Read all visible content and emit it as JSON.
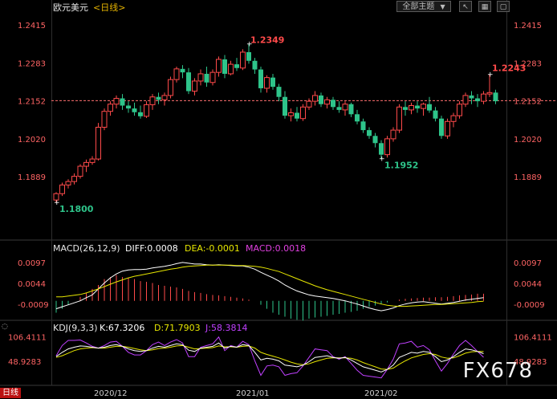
{
  "title": {
    "pair": "欧元美元",
    "period": "<日线>"
  },
  "toolbar": {
    "theme_label": "全部主题",
    "dropdown_icon": "triangle-down-icon",
    "cursor_icon": "cursor-icon",
    "calendar_icon": "calendar-icon",
    "box_icon": "box-icon"
  },
  "colors": {
    "up": "#ff4a4a",
    "down": "#2ec48a",
    "price_axis": "#ff6464",
    "diff": "#ffffff",
    "dea": "#e6e600",
    "macd": "#e040e0",
    "k": "#ffffff",
    "d": "#e6e600",
    "j": "#c040ff",
    "ref_line": "#ff7070"
  },
  "price": {
    "ticks": [
      "1.2415",
      "1.2283",
      "1.2152",
      "1.2020",
      "1.1889"
    ],
    "ref_value": 1.2152,
    "labels": {
      "high": "1.2349",
      "low": "1.1800",
      "recent_high": "1.2243",
      "swing_low": "1.1952"
    }
  },
  "macd": {
    "header": "MACD(26,12,9)",
    "diff_label": "DIFF:0.0008",
    "dea_label": "DEA:-0.0001",
    "macd_label": "MACD:0.0018",
    "ticks": [
      "0.0097",
      "0.0044",
      "-0.0009"
    ]
  },
  "kdj": {
    "header": "KDJ(9,3,3)",
    "k_label": "K:67.3206",
    "d_label": "D:71.7903",
    "j_label": "J:58.3814",
    "ticks": [
      "106.4111",
      "48.9283"
    ]
  },
  "dates": [
    "2020/12",
    "2021/01",
    "2021/02"
  ],
  "period_tag": "日线",
  "watermark": "FX678",
  "chart_data": {
    "type": "candlestick",
    "series_note": "daily OHLC, EUR/USD",
    "ylim": [
      1.175,
      1.2445
    ],
    "candles": [
      [
        1.1808,
        1.1835,
        1.18,
        1.183
      ],
      [
        1.183,
        1.1868,
        1.1822,
        1.186
      ],
      [
        1.186,
        1.188,
        1.1848,
        1.1872
      ],
      [
        1.1872,
        1.19,
        1.1862,
        1.189
      ],
      [
        1.189,
        1.1932,
        1.1882,
        1.1925
      ],
      [
        1.1925,
        1.1948,
        1.1905,
        1.1938
      ],
      [
        1.1938,
        1.196,
        1.193,
        1.195
      ],
      [
        1.195,
        1.2075,
        1.1945,
        1.206
      ],
      [
        1.206,
        1.2125,
        1.205,
        1.2115
      ],
      [
        1.2115,
        1.215,
        1.21,
        1.214
      ],
      [
        1.214,
        1.217,
        1.2125,
        1.216
      ],
      [
        1.216,
        1.2175,
        1.212,
        1.2135
      ],
      [
        1.2135,
        1.215,
        1.211,
        1.2125
      ],
      [
        1.2125,
        1.2145,
        1.21,
        1.2112
      ],
      [
        1.2112,
        1.2135,
        1.209,
        1.2098
      ],
      [
        1.2098,
        1.215,
        1.2092,
        1.2138
      ],
      [
        1.2138,
        1.2175,
        1.212,
        1.2165
      ],
      [
        1.2165,
        1.218,
        1.214,
        1.2155
      ],
      [
        1.2155,
        1.218,
        1.2135,
        1.217
      ],
      [
        1.217,
        1.2235,
        1.216,
        1.2225
      ],
      [
        1.2225,
        1.227,
        1.2215,
        1.2262
      ],
      [
        1.2262,
        1.2275,
        1.223,
        1.225
      ],
      [
        1.225,
        1.2265,
        1.2175,
        1.2185
      ],
      [
        1.2185,
        1.223,
        1.217,
        1.222
      ],
      [
        1.222,
        1.226,
        1.2205,
        1.2245
      ],
      [
        1.2245,
        1.227,
        1.22,
        1.2215
      ],
      [
        1.2215,
        1.226,
        1.2205,
        1.225
      ],
      [
        1.225,
        1.2305,
        1.2235,
        1.2295
      ],
      [
        1.2295,
        1.231,
        1.223,
        1.2245
      ],
      [
        1.2245,
        1.229,
        1.224,
        1.2278
      ],
      [
        1.2278,
        1.23,
        1.2255,
        1.2265
      ],
      [
        1.2265,
        1.233,
        1.2258,
        1.232
      ],
      [
        1.232,
        1.2349,
        1.228,
        1.229
      ],
      [
        1.229,
        1.23,
        1.2245,
        1.226
      ],
      [
        1.226,
        1.227,
        1.218,
        1.2195
      ],
      [
        1.2195,
        1.224,
        1.218,
        1.2232
      ],
      [
        1.2232,
        1.2245,
        1.219,
        1.22
      ],
      [
        1.22,
        1.221,
        1.215,
        1.2165
      ],
      [
        1.2165,
        1.2185,
        1.209,
        1.21
      ],
      [
        1.21,
        1.2125,
        1.208,
        1.211
      ],
      [
        1.211,
        1.213,
        1.208,
        1.209
      ],
      [
        1.209,
        1.214,
        1.2082,
        1.213
      ],
      [
        1.213,
        1.216,
        1.212,
        1.215
      ],
      [
        1.215,
        1.2185,
        1.2135,
        1.217
      ],
      [
        1.217,
        1.218,
        1.213,
        1.214
      ],
      [
        1.214,
        1.2165,
        1.2125,
        1.2155
      ],
      [
        1.2155,
        1.2165,
        1.212,
        1.213
      ],
      [
        1.213,
        1.215,
        1.211,
        1.212
      ],
      [
        1.212,
        1.215,
        1.21,
        1.214
      ],
      [
        1.214,
        1.2145,
        1.2095,
        1.2105
      ],
      [
        1.2105,
        1.212,
        1.207,
        1.208
      ],
      [
        1.208,
        1.209,
        1.204,
        1.205
      ],
      [
        1.205,
        1.206,
        1.202,
        1.203
      ],
      [
        1.203,
        1.204,
        1.199,
        1.2005
      ],
      [
        1.2005,
        1.2015,
        1.1952,
        1.1965
      ],
      [
        1.1965,
        1.203,
        1.1955,
        1.202
      ],
      [
        1.202,
        1.206,
        1.201,
        1.205
      ],
      [
        1.205,
        1.214,
        1.204,
        1.213
      ],
      [
        1.213,
        1.215,
        1.21,
        1.212
      ],
      [
        1.212,
        1.2145,
        1.2105,
        1.2135
      ],
      [
        1.2135,
        1.215,
        1.211,
        1.2125
      ],
      [
        1.2125,
        1.2145,
        1.21,
        1.214
      ],
      [
        1.214,
        1.2165,
        1.211,
        1.2118
      ],
      [
        1.2118,
        1.213,
        1.208,
        1.209
      ],
      [
        1.209,
        1.21,
        1.202,
        1.203
      ],
      [
        1.203,
        1.209,
        1.202,
        1.208
      ],
      [
        1.208,
        1.211,
        1.206,
        1.21
      ],
      [
        1.21,
        1.215,
        1.209,
        1.214
      ],
      [
        1.214,
        1.218,
        1.213,
        1.217
      ],
      [
        1.217,
        1.2185,
        1.214,
        1.216
      ],
      [
        1.216,
        1.2175,
        1.213,
        1.215
      ],
      [
        1.215,
        1.2185,
        1.214,
        1.2175
      ],
      [
        1.2175,
        1.2243,
        1.2165,
        1.218
      ],
      [
        1.218,
        1.219,
        1.214,
        1.215
      ]
    ],
    "macd_hist": [
      -0.003,
      -0.002,
      -0.001,
      0.0,
      0.001,
      0.002,
      0.003,
      0.004,
      0.0055,
      0.006,
      0.0065,
      0.006,
      0.0058,
      0.0055,
      0.005,
      0.0048,
      0.0045,
      0.004,
      0.0038,
      0.0036,
      0.0034,
      0.003,
      0.0025,
      0.0022,
      0.002,
      0.0017,
      0.0015,
      0.0014,
      0.0012,
      0.001,
      0.0008,
      0.0006,
      0.0003,
      0.0,
      -0.001,
      -0.002,
      -0.003,
      -0.0035,
      -0.004,
      -0.0045,
      -0.0048,
      -0.005,
      -0.0045,
      -0.0042,
      -0.004,
      -0.0038,
      -0.0035,
      -0.0033,
      -0.003,
      -0.0028,
      -0.0025,
      -0.002,
      -0.0015,
      -0.0012,
      -0.0008,
      -0.0004,
      0.0,
      0.0003,
      0.0005,
      0.0006,
      0.0007,
      0.0008,
      0.0008,
      0.0009,
      0.0009,
      0.001,
      0.0012,
      0.0014,
      0.0015,
      0.0016,
      0.0018,
      0.0018
    ],
    "macd_diff": [
      -0.002,
      -0.0015,
      -0.001,
      -0.0005,
      0.0,
      0.0008,
      0.0015,
      0.003,
      0.0045,
      0.0058,
      0.0068,
      0.0075,
      0.0078,
      0.0079,
      0.0079,
      0.008,
      0.0083,
      0.0085,
      0.0087,
      0.009,
      0.0094,
      0.0097,
      0.0095,
      0.0093,
      0.0093,
      0.0091,
      0.009,
      0.0091,
      0.009,
      0.0089,
      0.0088,
      0.0088,
      0.0085,
      0.008,
      0.0072,
      0.0065,
      0.0058,
      0.005,
      0.004,
      0.0032,
      0.0025,
      0.002,
      0.0015,
      0.0012,
      0.001,
      0.0008,
      0.0006,
      0.0003,
      0.0,
      -0.0004,
      -0.0008,
      -0.0013,
      -0.0018,
      -0.0022,
      -0.0025,
      -0.0022,
      -0.0018,
      -0.0012,
      -0.0008,
      -0.0005,
      -0.0003,
      -0.0002,
      -0.0004,
      -0.0006,
      -0.0008,
      -0.0006,
      -0.0004,
      -0.0001,
      0.0002,
      0.0004,
      0.0006,
      0.0008
    ],
    "macd_dea": [
      0.001,
      0.001,
      0.0012,
      0.0014,
      0.0016,
      0.002,
      0.0025,
      0.003,
      0.0036,
      0.0042,
      0.0048,
      0.0053,
      0.0058,
      0.0062,
      0.0065,
      0.0068,
      0.0071,
      0.0074,
      0.0077,
      0.008,
      0.0082,
      0.0085,
      0.0087,
      0.0088,
      0.0089,
      0.009,
      0.009,
      0.009,
      0.009,
      0.009,
      0.0089,
      0.0089,
      0.0088,
      0.0087,
      0.0085,
      0.0082,
      0.0078,
      0.0074,
      0.0068,
      0.0062,
      0.0056,
      0.005,
      0.0044,
      0.0038,
      0.0033,
      0.0028,
      0.0024,
      0.002,
      0.0016,
      0.0012,
      0.0008,
      0.0004,
      0.0,
      -0.0004,
      -0.0008,
      -0.0011,
      -0.0013,
      -0.0014,
      -0.0014,
      -0.0013,
      -0.0012,
      -0.0011,
      -0.001,
      -0.0009,
      -0.0009,
      -0.0008,
      -0.0007,
      -0.0006,
      -0.0005,
      -0.0004,
      -0.0002,
      -0.0001
    ],
    "kdj_k": [
      60,
      70,
      78,
      82,
      85,
      84,
      82,
      80,
      82,
      86,
      88,
      84,
      78,
      74,
      72,
      74,
      80,
      84,
      82,
      86,
      90,
      88,
      75,
      72,
      80,
      82,
      84,
      92,
      80,
      84,
      82,
      88,
      86,
      70,
      52,
      56,
      54,
      50,
      40,
      38,
      36,
      40,
      48,
      58,
      60,
      62,
      58,
      56,
      58,
      52,
      44,
      36,
      32,
      28,
      24,
      30,
      40,
      58,
      64,
      70,
      68,
      72,
      70,
      60,
      48,
      52,
      60,
      70,
      78,
      76,
      72,
      67
    ],
    "kdj_d": [
      58,
      62,
      68,
      74,
      78,
      80,
      81,
      80,
      80,
      82,
      84,
      84,
      82,
      79,
      76,
      74,
      76,
      79,
      80,
      82,
      85,
      86,
      82,
      78,
      79,
      80,
      81,
      85,
      83,
      83,
      82,
      84,
      85,
      80,
      70,
      65,
      61,
      57,
      52,
      47,
      43,
      41,
      43,
      48,
      52,
      56,
      57,
      57,
      57,
      56,
      52,
      46,
      41,
      36,
      31,
      30,
      33,
      42,
      50,
      57,
      61,
      65,
      67,
      65,
      59,
      56,
      57,
      62,
      68,
      71,
      72,
      71.8
    ],
    "kdj_j": [
      62,
      86,
      98,
      98,
      99,
      92,
      84,
      80,
      86,
      94,
      96,
      84,
      70,
      64,
      64,
      74,
      88,
      94,
      86,
      94,
      100,
      92,
      60,
      60,
      82,
      86,
      90,
      106,
      74,
      86,
      82,
      96,
      88,
      50,
      16,
      38,
      40,
      36,
      16,
      20,
      22,
      38,
      58,
      78,
      76,
      74,
      60,
      54,
      60,
      44,
      28,
      16,
      14,
      12,
      10,
      30,
      54,
      90,
      92,
      96,
      82,
      86,
      76,
      50,
      26,
      44,
      66,
      86,
      98,
      86,
      72,
      58.4
    ]
  }
}
